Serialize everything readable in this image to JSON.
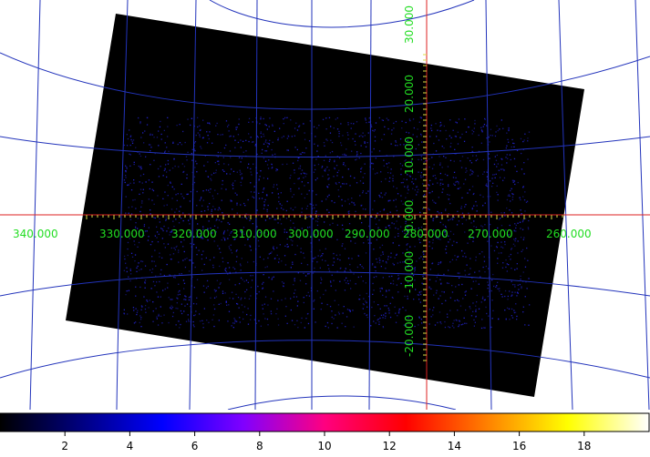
{
  "image": {
    "background_color": "#ffffff",
    "data_color": "#000000",
    "source_color": "#2222cc",
    "grid_color": "#2233bb",
    "crosshair_color": "#dd2222",
    "label_color": "#22dd22"
  },
  "grid_labels": {
    "longitude": [
      "340.000",
      "330.000",
      "320.000",
      "310.000",
      "300.000",
      "290.000",
      "280.000",
      "270.000",
      "260.000"
    ],
    "latitude": [
      "30.000",
      "20.000",
      "10.000",
      "0.000",
      "-10.000",
      "-20.000"
    ]
  },
  "colorbar": {
    "min": 0,
    "max": 20,
    "ticks": [
      "2",
      "4",
      "6",
      "8",
      "10",
      "12",
      "14",
      "16",
      "18"
    ],
    "colormap": [
      "#000000",
      "#000080",
      "#0000ff",
      "#8000ff",
      "#ff0080",
      "#ff0000",
      "#ff8000",
      "#ffff00",
      "#ffffff"
    ]
  }
}
